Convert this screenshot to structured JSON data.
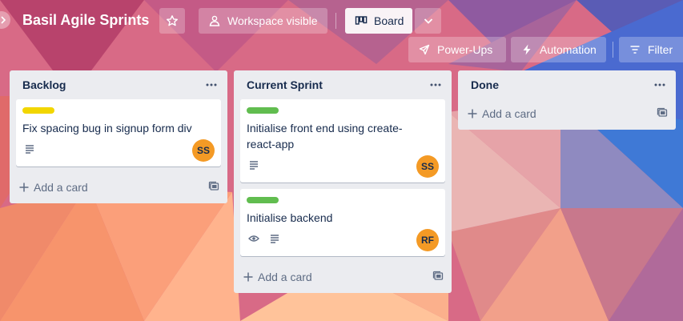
{
  "board": {
    "title": "Basil Agile Sprints",
    "visibility_label": "Workspace visible",
    "view_label": "Board"
  },
  "toolbar": {
    "powerups_label": "Power-Ups",
    "automation_label": "Automation",
    "filter_label": "Filter"
  },
  "lists": [
    {
      "title": "Backlog",
      "add_label": "Add a card",
      "cards": [
        {
          "label_color": "#f2d600",
          "title": "Fix spacing bug in signup form div",
          "avatar": "SS"
        }
      ]
    },
    {
      "title": "Current Sprint",
      "add_label": "Add a card",
      "cards": [
        {
          "label_color": "#61bd4f",
          "title": "Initialise front end using create-react-app",
          "avatar": "SS"
        },
        {
          "label_color": "#61bd4f",
          "title": "Initialise backend",
          "avatar": "RF"
        }
      ]
    },
    {
      "title": "Done",
      "add_label": "Add a card",
      "cards": []
    }
  ],
  "colors": {
    "list_bg": "#ebecf0",
    "avatar_bg": "#f49a25",
    "label_yellow": "#f2d600",
    "label_green": "#61bd4f"
  },
  "icons": [
    "back-arrow-icon",
    "star-icon",
    "people-icon",
    "board-icon",
    "chevron-down-icon",
    "rocket-icon",
    "lightning-icon",
    "filter-icon",
    "ellipsis-icon",
    "description-icon",
    "eye-icon",
    "plus-icon",
    "card-template-icon"
  ]
}
